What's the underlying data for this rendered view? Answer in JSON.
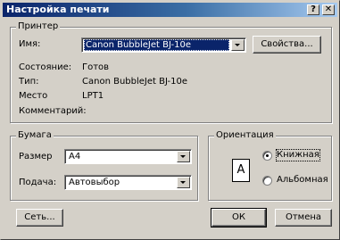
{
  "window": {
    "title": "Настройка печати",
    "help_button": "?",
    "close_button": "✕"
  },
  "printer": {
    "group_label": "Принтер",
    "name_label": "Имя:",
    "name_value": "Canon BubbleJet BJ-10e",
    "properties_button": "Свойства...",
    "status_label": "Состояние:",
    "status_value": "Готов",
    "type_label": "Тип:",
    "type_value": "Canon BubbleJet BJ-10e",
    "where_label": "Место",
    "where_value": "LPT1",
    "comment_label": "Комментарий:",
    "comment_value": ""
  },
  "paper": {
    "group_label": "Бумага",
    "size_label": "Размер",
    "size_value": "A4",
    "source_label": "Подача:",
    "source_value": "Автовыбор"
  },
  "orientation": {
    "group_label": "Ориентация",
    "icon_letter": "A",
    "portrait_label": "Книжная",
    "landscape_label": "Альбомная",
    "selected": "portrait"
  },
  "footer": {
    "network_button": "Сеть...",
    "ok_button": "ОК",
    "cancel_button": "Отмена"
  }
}
